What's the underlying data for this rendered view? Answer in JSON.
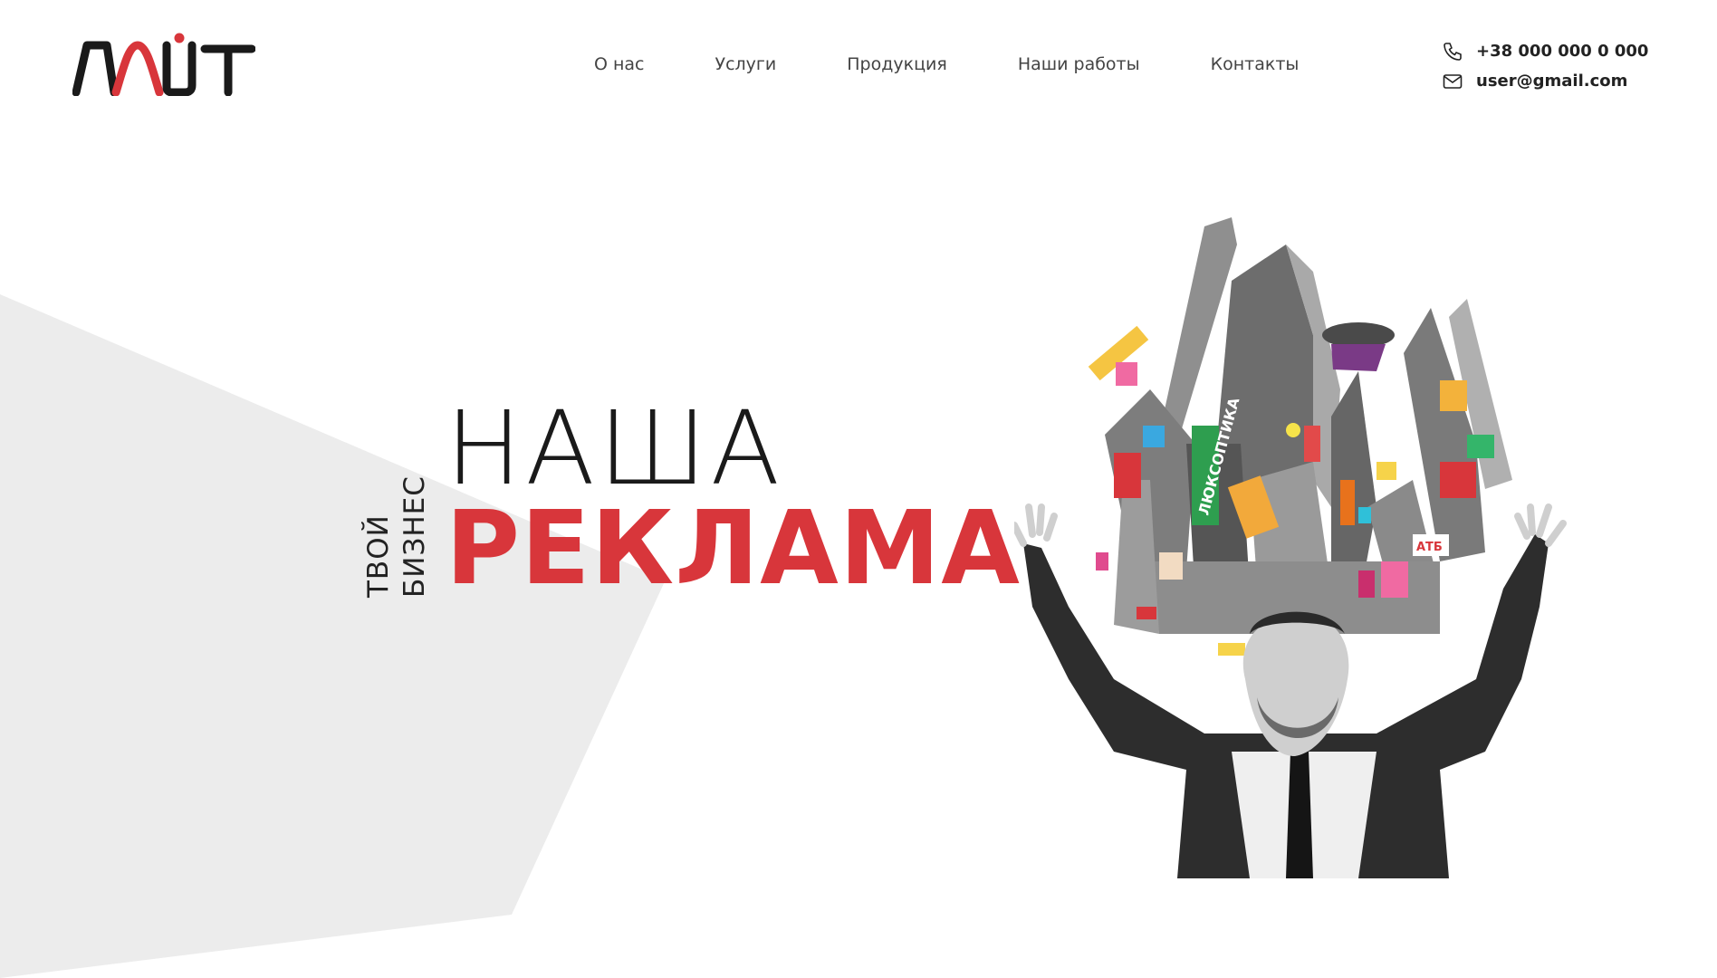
{
  "brand": {
    "logo_text": "ЛАЙТ",
    "accent_color": "#d8363b",
    "dark_color": "#1a1a1a"
  },
  "nav": {
    "items": [
      {
        "label": "О нас"
      },
      {
        "label": "Услуги"
      },
      {
        "label": "Продукция"
      },
      {
        "label": "Наши работы"
      },
      {
        "label": "Контакты"
      }
    ]
  },
  "contacts": {
    "phone": "+38 000 000 0 000",
    "phone_icon": "phone-icon",
    "email": "user@gmail.com",
    "email_icon": "mail-icon"
  },
  "hero": {
    "tagline_line1": "ТВОЙ",
    "tagline_line2": "БИЗНЕС",
    "headline_line1": "НАША",
    "headline_line2": "РЕКЛАМА",
    "visual": {
      "description_icon": "businessman-city-collage-image",
      "billboard_text_1": "ЛЮКСОПТИКА",
      "billboard_text_2": "АТБ"
    }
  },
  "colors": {
    "background": "#ffffff",
    "gray_shape": "#ececec",
    "text": "#222222"
  }
}
